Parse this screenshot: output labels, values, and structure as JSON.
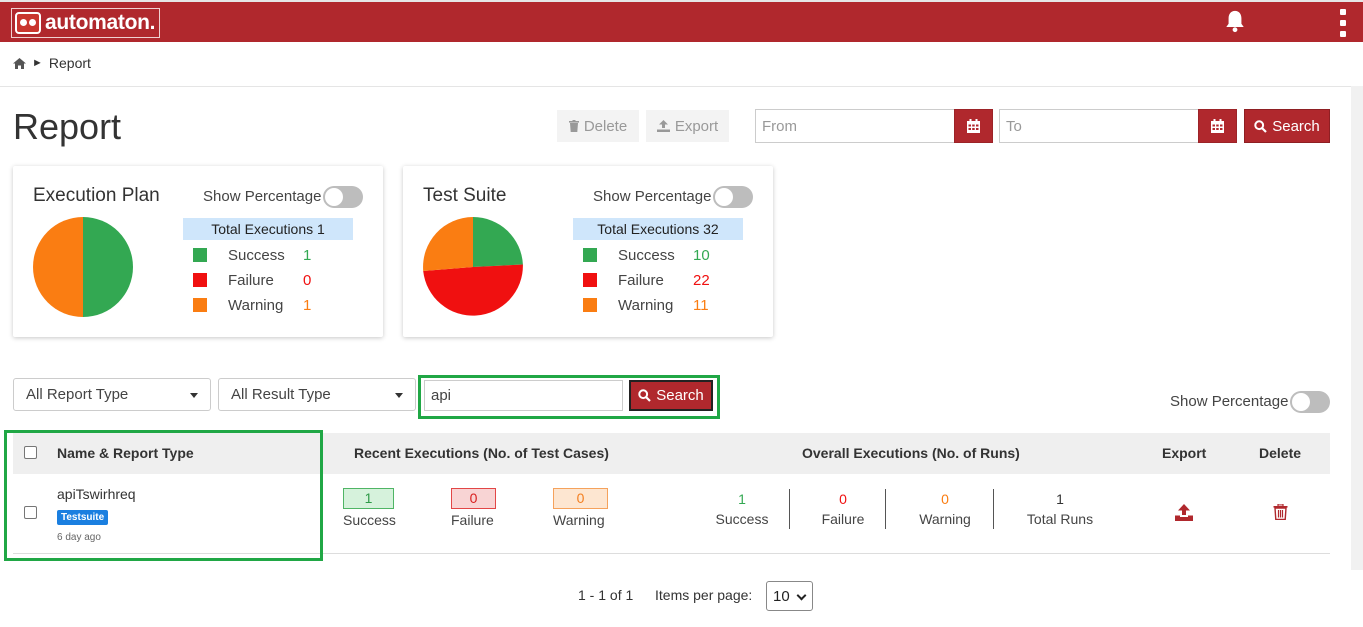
{
  "header": {
    "logo_text": "automaton.",
    "bell_icon": "bell-icon",
    "menu_icon": "kebab-menu-icon"
  },
  "breadcrumb": {
    "home_icon": "home-icon",
    "separator": "►",
    "current": "Report"
  },
  "page": {
    "title": "Report"
  },
  "toolbar": {
    "delete_label": "Delete",
    "export_label": "Export",
    "from_placeholder": "From",
    "to_placeholder": "To",
    "search_label": "Search"
  },
  "cards": [
    {
      "title": "Execution Plan",
      "show_percentage_label": "Show Percentage",
      "total_label": "Total Executions 1",
      "stats": [
        {
          "label": "Success",
          "value": "1",
          "color": "#33a852"
        },
        {
          "label": "Failure",
          "value": "0",
          "color": "#f01010"
        },
        {
          "label": "Warning",
          "value": "1",
          "color": "#fa7d12"
        }
      ]
    },
    {
      "title": "Test Suite",
      "show_percentage_label": "Show Percentage",
      "total_label": "Total Executions 32",
      "stats": [
        {
          "label": "Success",
          "value": "10",
          "color": "#33a852"
        },
        {
          "label": "Failure",
          "value": "22",
          "color": "#f01010"
        },
        {
          "label": "Warning",
          "value": "11",
          "color": "#fa7d12"
        }
      ]
    }
  ],
  "filters": {
    "report_type": "All Report Type",
    "result_type": "All Result Type",
    "search_value": "api",
    "search_label": "Search",
    "show_percentage_label": "Show Percentage"
  },
  "table": {
    "headers": {
      "name": "Name & Report Type",
      "recent": "Recent Executions (No. of Test Cases)",
      "overall": "Overall Executions (No. of Runs)",
      "export": "Export",
      "delete": "Delete"
    },
    "rows": [
      {
        "name": "apiTswirhreq",
        "type_tag": "Testsuite",
        "age": "6 day ago",
        "recent": {
          "success": "1",
          "success_label": "Success",
          "failure": "0",
          "failure_label": "Failure",
          "warning": "0",
          "warning_label": "Warning"
        },
        "overall": {
          "success": "1",
          "success_label": "Success",
          "failure": "0",
          "failure_label": "Failure",
          "warning": "0",
          "warning_label": "Warning",
          "total": "1",
          "total_label": "Total Runs"
        },
        "export_icon": "upload-icon",
        "delete_icon": "trash-icon"
      }
    ]
  },
  "pagination": {
    "range": "1 - 1 of 1",
    "items_per_page_label": "Items per page:",
    "items_per_page": "10"
  },
  "colors": {
    "brand": "#b0282d",
    "success": "#33a852",
    "failure": "#f01010",
    "warning": "#fa7d12",
    "highlight": "#20a745"
  }
}
